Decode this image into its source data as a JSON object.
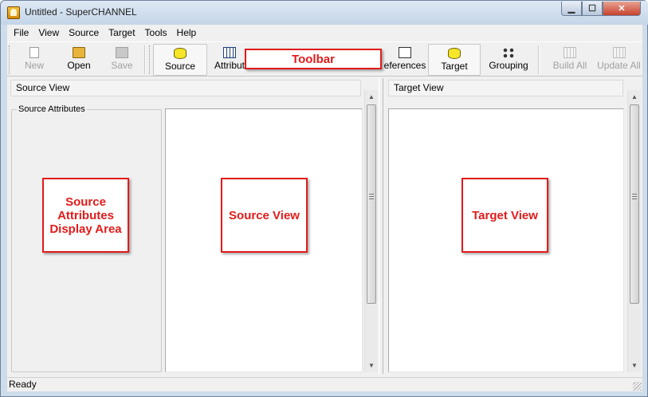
{
  "window": {
    "title": "Untitled - SuperCHANNEL",
    "min_glyph": "▁",
    "max_glyph": "☐",
    "close_glyph": "✕"
  },
  "menu": [
    "File",
    "View",
    "Source",
    "Target",
    "Tools",
    "Help"
  ],
  "toolbar": {
    "new": "New",
    "open": "Open",
    "save": "Save",
    "source": "Source",
    "attributes": "Attribut",
    "preferences": "eferences",
    "target": "Target",
    "grouping": "Grouping",
    "build_all": "Build All",
    "update_all": "Update All"
  },
  "source_pane": {
    "header": "Source View",
    "attributes_group": "Source Attributes"
  },
  "target_pane": {
    "header": "Target View"
  },
  "callouts": {
    "toolbar": "Toolbar",
    "source_attributes": "Source Attributes Display Area",
    "source_view": "Source View",
    "target_view": "Target View"
  },
  "scroll_arrows": {
    "up": "▲",
    "down": "▼",
    "mid": "≡"
  },
  "statusbar": {
    "text": "Ready"
  },
  "colors": {
    "callout_red": "#e21b1b",
    "chrome": "#f0f0f0",
    "db_yellow": "#f6e529"
  }
}
